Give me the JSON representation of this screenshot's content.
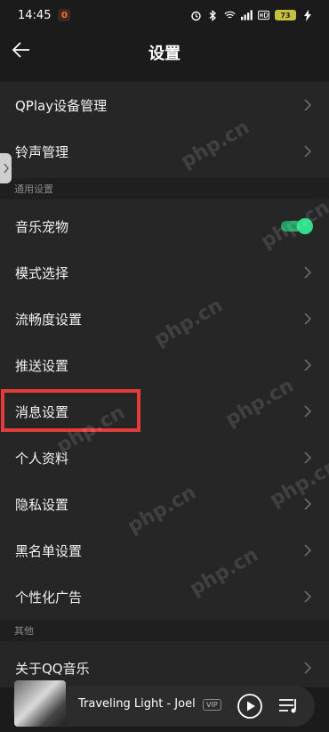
{
  "status_bar": {
    "time": "14:45",
    "notification_badge": "0",
    "battery": "73"
  },
  "header": {
    "title": "设置"
  },
  "rows_top": [
    {
      "label": "QPlay设备管理"
    },
    {
      "label": "铃声管理"
    }
  ],
  "section_general": "通用设置",
  "rows_general": [
    {
      "label": "音乐宠物",
      "toggle": true
    },
    {
      "label": "模式选择"
    },
    {
      "label": "流畅度设置"
    },
    {
      "label": "推送设置"
    },
    {
      "label": "消息设置"
    },
    {
      "label": "个人资料"
    },
    {
      "label": "隐私设置"
    },
    {
      "label": "黑名单设置"
    },
    {
      "label": "个性化广告"
    }
  ],
  "section_other": "其他",
  "rows_other": [
    {
      "label": "关于QQ音乐"
    }
  ],
  "player": {
    "song": "Traveling Light - Joel",
    "vip": "VIP"
  },
  "watermark": "php.cn",
  "colors": {
    "toggle_on": "#31e08a",
    "highlight": "#e43b3b"
  }
}
